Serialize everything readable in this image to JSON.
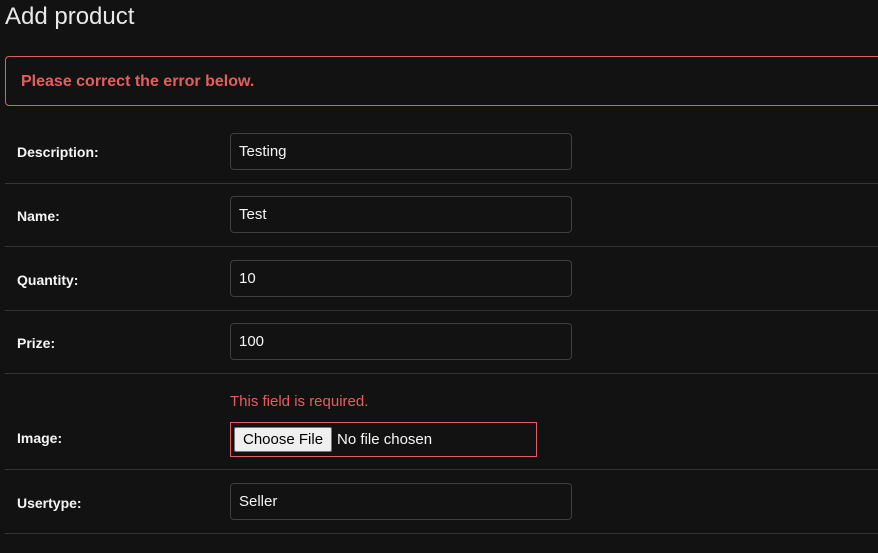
{
  "page": {
    "title": "Add product"
  },
  "errornote": {
    "text": "Please correct the error below."
  },
  "fields": {
    "description": {
      "label": "Description:",
      "value": "Testing"
    },
    "name": {
      "label": "Name:",
      "value": "Test"
    },
    "quantity": {
      "label": "Quantity:",
      "value": "10"
    },
    "prize": {
      "label": "Prize:",
      "value": "100"
    },
    "image": {
      "label": "Image:",
      "error": "This field is required.",
      "button_label": "Choose File",
      "status": "No file chosen"
    },
    "usertype": {
      "label": "Usertype:",
      "value": "Seller"
    }
  },
  "colors": {
    "background": "#121212",
    "error": "#e35f5f",
    "border": "#3f3f3f",
    "text": "#f5f5f5"
  }
}
